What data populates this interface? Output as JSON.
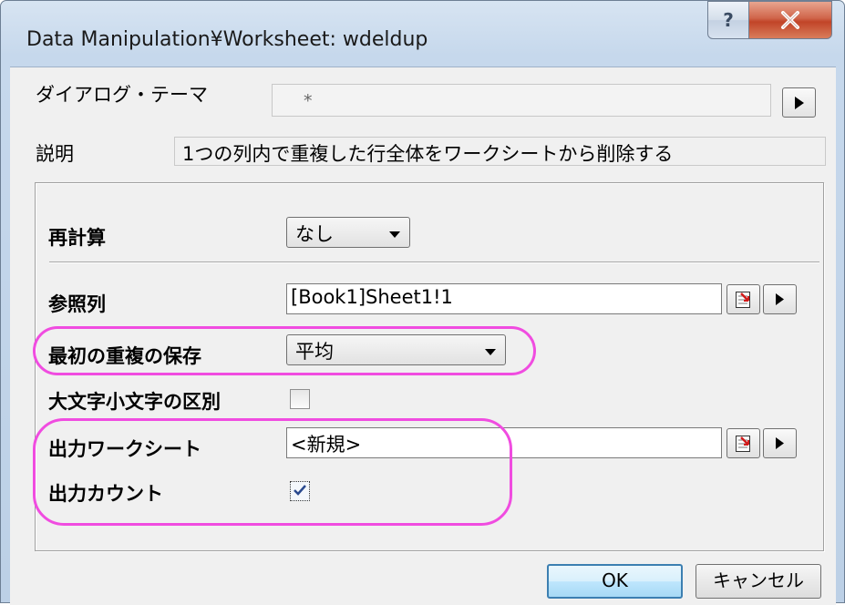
{
  "window": {
    "title": "Data Manipulation¥Worksheet: wdeldup",
    "help_label": "?"
  },
  "dialog_theme": {
    "label": "ダイアログ・テーマ",
    "value": "*"
  },
  "description": {
    "label": "説明",
    "text": "1つの列内で重複した行全体をワークシートから削除する"
  },
  "recalculate": {
    "label": "再計算",
    "value": "なし"
  },
  "reference_column": {
    "label": "参照列",
    "value": "[Book1]Sheet1!1"
  },
  "keep_first_duplicate": {
    "label": "最初の重複の保存",
    "value": "平均"
  },
  "case_sensitive": {
    "label": "大文字小文字の区別",
    "checked": false
  },
  "output_worksheet": {
    "label": "出力ワークシート",
    "value": "<新規>"
  },
  "output_count": {
    "label": "出力カウント",
    "checked": true
  },
  "buttons": {
    "ok": "OK",
    "cancel": "キャンセル"
  },
  "colors": {
    "highlight": "#f04ce0",
    "close_button": "#c14428"
  }
}
